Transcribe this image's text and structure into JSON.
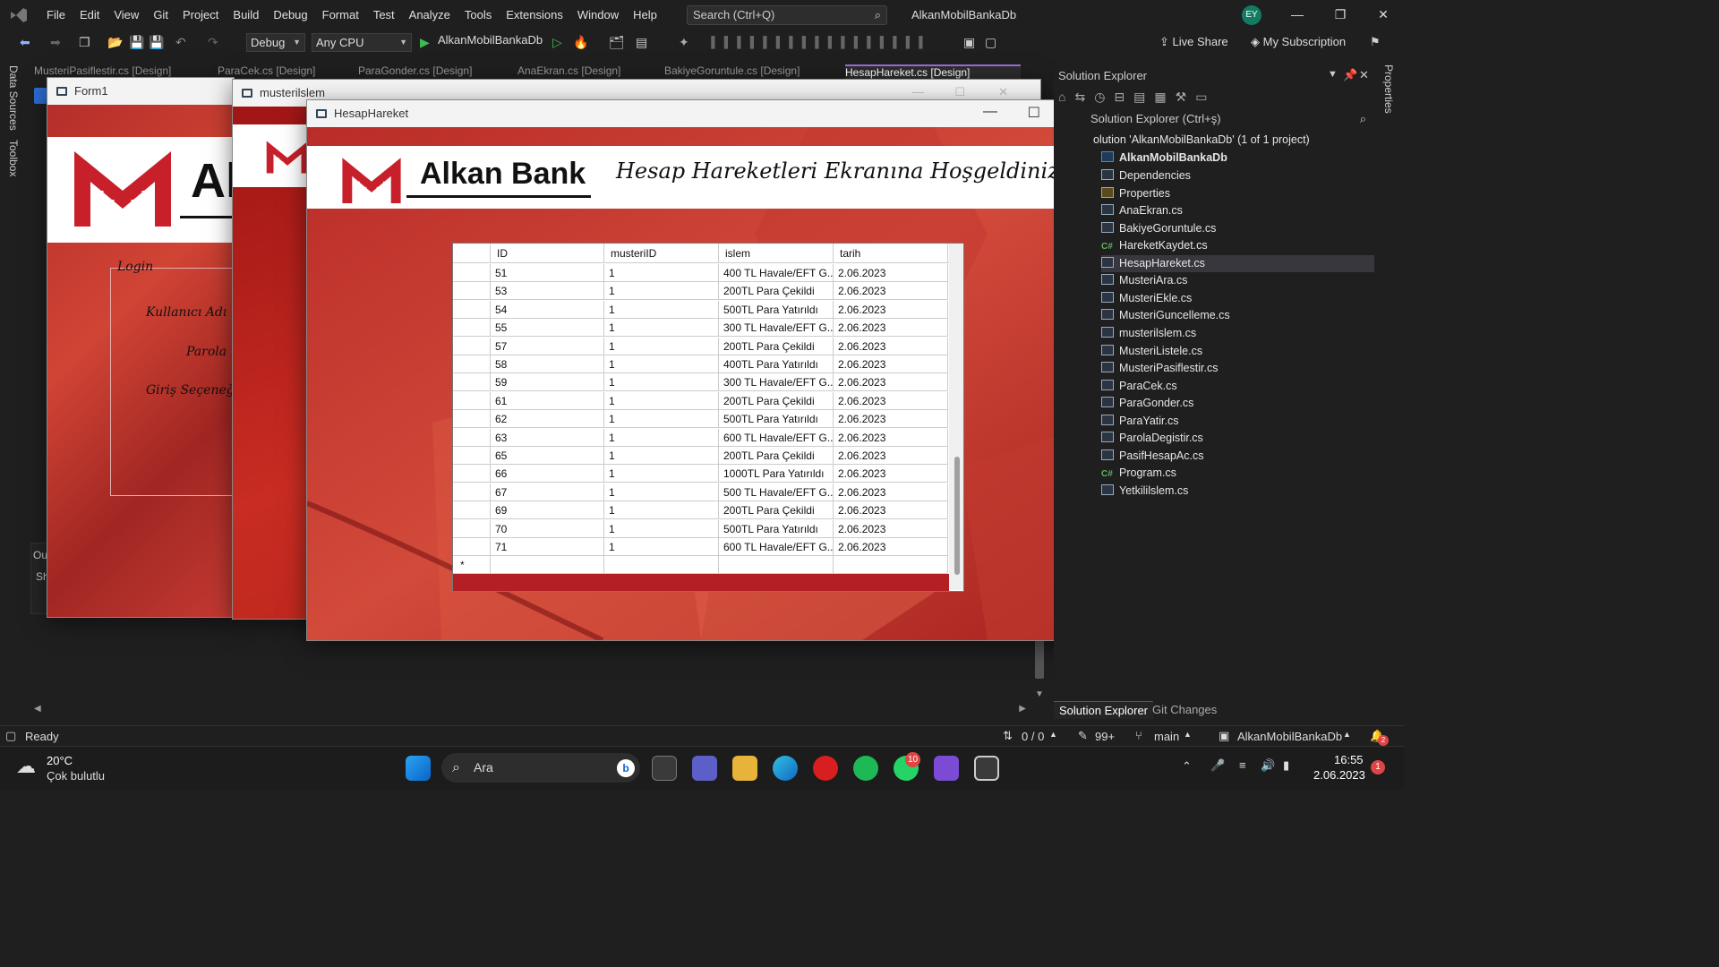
{
  "menu": [
    "File",
    "Edit",
    "View",
    "Git",
    "Project",
    "Build",
    "Debug",
    "Format",
    "Test",
    "Analyze",
    "Tools",
    "Extensions",
    "Window",
    "Help"
  ],
  "search_label": "Search (Ctrl+Q)",
  "app_title": "AlkanMobilBankaDb",
  "avatar_initials": "EY",
  "toolbar": {
    "config": "Debug",
    "platform": "Any CPU",
    "run_target": "AlkanMobilBankaDb",
    "live_share": "Live Share",
    "subscription": "My Subscription"
  },
  "left_strip": {
    "data_sources": "Data Sources",
    "toolbox": "Toolbox"
  },
  "doc_tabs": [
    "MusteriPasiflestir.cs [Design]",
    "ParaCek.cs [Design]",
    "ParaGonder.cs [Design]",
    "AnaEkran.cs [Design]",
    "BakiyeGoruntule.cs [Design]",
    "HesapHareket.cs [Design]"
  ],
  "output_panel": {
    "label1": "Ou",
    "label2": "Sh"
  },
  "form1": {
    "title": "Form1",
    "bank": "Al",
    "group": "Login",
    "label_user": "Kullanıcı Adı :",
    "label_pass": "Parola",
    "label_option": "Giriş Seçeneği"
  },
  "musteri": {
    "title": "musterilslem"
  },
  "hesap": {
    "title": "HesapHareket",
    "bank": "Alkan Bank",
    "welcome": "Hesap Hareketleri Ekranına Hoşgeldiniz"
  },
  "grid": {
    "headers": [
      "ID",
      "musteriID",
      "islem",
      "tarih"
    ],
    "rows": [
      [
        "51",
        "1",
        "400 TL Havale/EFT G...",
        "2.06.2023"
      ],
      [
        "53",
        "1",
        "200TL Para Çekildi",
        "2.06.2023"
      ],
      [
        "54",
        "1",
        "500TL Para Yatırıldı",
        "2.06.2023"
      ],
      [
        "55",
        "1",
        "300 TL Havale/EFT G...",
        "2.06.2023"
      ],
      [
        "57",
        "1",
        "200TL Para Çekildi",
        "2.06.2023"
      ],
      [
        "58",
        "1",
        "400TL Para Yatırıldı",
        "2.06.2023"
      ],
      [
        "59",
        "1",
        "300 TL Havale/EFT G...",
        "2.06.2023"
      ],
      [
        "61",
        "1",
        "200TL Para Çekildi",
        "2.06.2023"
      ],
      [
        "62",
        "1",
        "500TL Para Yatırıldı",
        "2.06.2023"
      ],
      [
        "63",
        "1",
        "600 TL Havale/EFT G...",
        "2.06.2023"
      ],
      [
        "65",
        "1",
        "200TL Para Çekildi",
        "2.06.2023"
      ],
      [
        "66",
        "1",
        "1000TL Para Yatırıldı",
        "2.06.2023"
      ],
      [
        "67",
        "1",
        "500 TL Havale/EFT G...",
        "2.06.2023"
      ],
      [
        "69",
        "1",
        "200TL Para Çekildi",
        "2.06.2023"
      ],
      [
        "70",
        "1",
        "500TL Para Yatırıldı",
        "2.06.2023"
      ],
      [
        "71",
        "1",
        "600 TL Havale/EFT G...",
        "2.06.2023"
      ]
    ],
    "new_row_marker": "*"
  },
  "solution": {
    "header": "Solution Explorer",
    "search": "Solution Explorer (Ctrl+ş)",
    "solution_line": "olution 'AlkanMobilBankaDb' (1 of 1 project)",
    "project": "AlkanMobilBankaDb",
    "items": [
      {
        "label": "Dependencies",
        "kind": "dep"
      },
      {
        "label": "Properties",
        "kind": "folder"
      },
      {
        "label": "AnaEkran.cs",
        "kind": "form"
      },
      {
        "label": "BakiyeGoruntule.cs",
        "kind": "form"
      },
      {
        "label": "HareketKaydet.cs",
        "kind": "cs"
      },
      {
        "label": "HesapHareket.cs",
        "kind": "form",
        "selected": true
      },
      {
        "label": "MusteriAra.cs",
        "kind": "form"
      },
      {
        "label": "MusteriEkle.cs",
        "kind": "form"
      },
      {
        "label": "MusteriGuncelleme.cs",
        "kind": "form"
      },
      {
        "label": "musterilslem.cs",
        "kind": "form"
      },
      {
        "label": "MusteriListele.cs",
        "kind": "form"
      },
      {
        "label": "MusteriPasiflestir.cs",
        "kind": "form"
      },
      {
        "label": "ParaCek.cs",
        "kind": "form"
      },
      {
        "label": "ParaGonder.cs",
        "kind": "form"
      },
      {
        "label": "ParaYatir.cs",
        "kind": "form"
      },
      {
        "label": "ParolaDegistir.cs",
        "kind": "form"
      },
      {
        "label": "PasifHesapAc.cs",
        "kind": "form"
      },
      {
        "label": "Program.cs",
        "kind": "cs"
      },
      {
        "label": "Yetkililslem.cs",
        "kind": "form"
      }
    ],
    "tab1": "Solution Explorer",
    "tab2": "Git Changes",
    "properties": "Properties"
  },
  "status": {
    "ready": "Ready",
    "errors": "0 / 0",
    "edits": "99+",
    "branch": "main",
    "repo": "AlkanMobilBankaDb",
    "notif": "2"
  },
  "taskbar": {
    "temp": "20°C",
    "weather": "Çok bulutlu",
    "search": "Ara",
    "whatsapp_badge": "10",
    "time": "16:55",
    "date": "2.06.2023",
    "notif": "1"
  },
  "colors": {
    "accent": "#9b6dd6",
    "bank_red": "#b41f23",
    "selection": "#37373d"
  }
}
